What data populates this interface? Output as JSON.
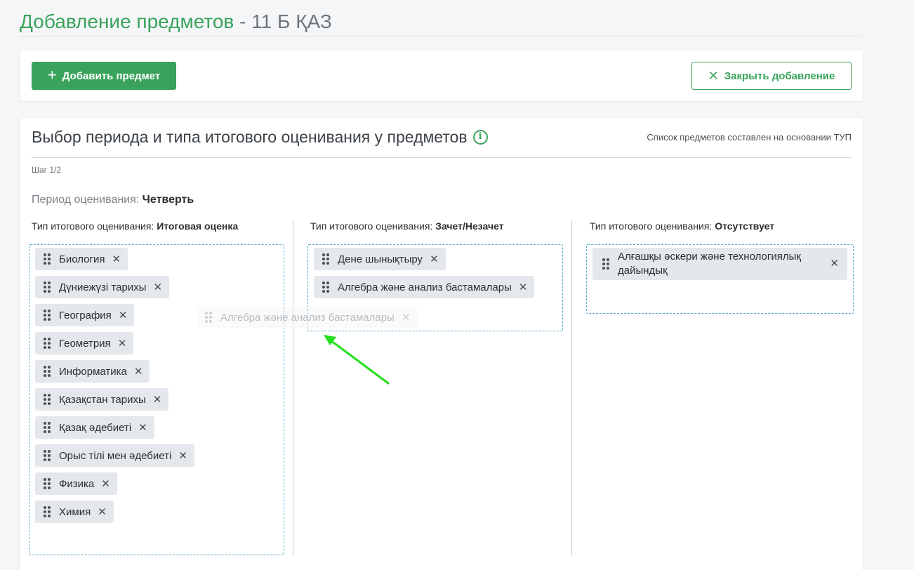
{
  "header": {
    "title_main": "Добавление предметов",
    "title_sep": " - ",
    "title_class": "11 Б ҚАЗ"
  },
  "toolbar": {
    "add_label": "Добавить предмет",
    "close_label": "Закрыть добавление"
  },
  "section": {
    "title": "Выбор периода и типа итогового оценивания у предметов",
    "note": "Список предметов составлен на основании ТУП",
    "step": "Шаг 1/2",
    "period_label": "Период оценивания:",
    "period_value": "Четверть"
  },
  "columns": [
    {
      "label": "Тип итогового оценивания:",
      "value": "Итоговая оценка",
      "items": [
        "Биология",
        "Дүниежүзі тарихы",
        "География",
        "Геометрия",
        "Информатика",
        "Қазақстан тарихы",
        "Қазақ әдебиеті",
        "Орыс тілі мен әдебиеті",
        "Физика",
        "Химия"
      ]
    },
    {
      "label": "Тип итогового оценивания:",
      "value": "Зачет/Незачет",
      "items": [
        "Дене шынықтыру",
        "Алгебра және анализ бастамалары"
      ]
    },
    {
      "label": "Тип итогового оценивания:",
      "value": "Отсутствует",
      "items": [
        "Алғашқы әскери және технологиялық дайындық"
      ]
    }
  ],
  "drag_ghost": "Алгебра және анализ бастамалары",
  "colors": {
    "accent": "#3aa35b",
    "dropzone_border": "#56a8c7",
    "chip_bg": "#e4e7eb",
    "arrow": "#22e01a"
  },
  "icons": {
    "add": "plus-icon",
    "close": "close-icon",
    "info": "info-circle-icon",
    "grip": "drag-handle-icon",
    "remove": "remove-x-icon"
  }
}
